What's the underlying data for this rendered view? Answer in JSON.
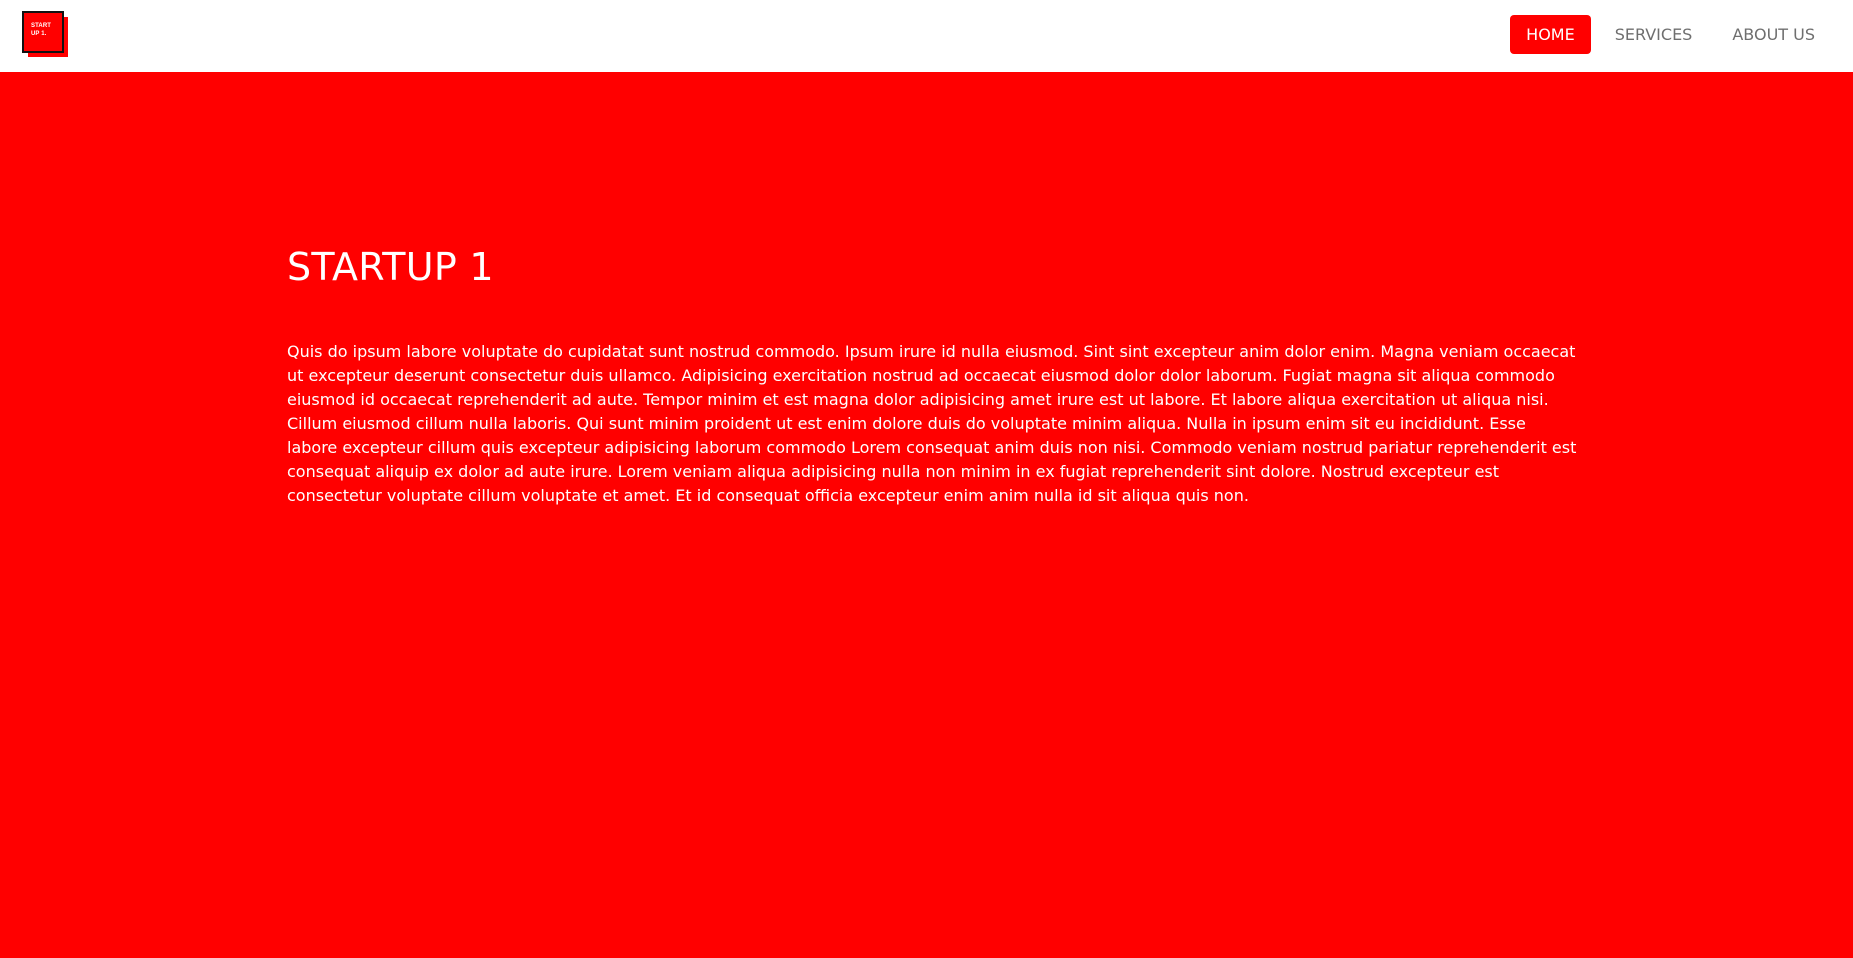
{
  "brand": {
    "logo_text": "START UP 1."
  },
  "nav": {
    "items": [
      {
        "label": "HOME",
        "active": true
      },
      {
        "label": "SERVICES",
        "active": false
      },
      {
        "label": "ABOUT US",
        "active": false
      }
    ]
  },
  "hero": {
    "title": "STARTUP 1",
    "body": "Quis do ipsum labore voluptate do cupidatat sunt nostrud commodo. Ipsum irure id nulla eiusmod. Sint sint excepteur anim dolor enim. Magna veniam occaecat ut excepteur deserunt consectetur duis ullamco. Adipisicing exercitation nostrud ad occaecat eiusmod dolor dolor laborum. Fugiat magna sit aliqua commodo eiusmod id occaecat reprehenderit ad aute. Tempor minim et est magna dolor adipisicing amet irure est ut labore. Et labore aliqua exercitation ut aliqua nisi. Cillum eiusmod cillum nulla laboris. Qui sunt minim proident ut est enim dolore duis do voluptate minim aliqua. Nulla in ipsum enim sit eu incididunt. Esse labore excepteur cillum quis excepteur adipisicing laborum commodo Lorem consequat anim duis non nisi. Commodo veniam nostrud pariatur reprehenderit est consequat aliquip ex dolor ad aute irure. Lorem veniam aliqua adipisicing nulla non minim in ex fugiat reprehenderit sint dolore. Nostrud excepteur est consectetur voluptate cillum voluptate et amet. Et id consequat officia excepteur enim anim nulla id sit aliqua quis non."
  },
  "colors": {
    "accent": "#ff0000",
    "navbar_bg": "#ffffff",
    "nav_text": "#6f6f6f",
    "logo_border": "#111111"
  }
}
